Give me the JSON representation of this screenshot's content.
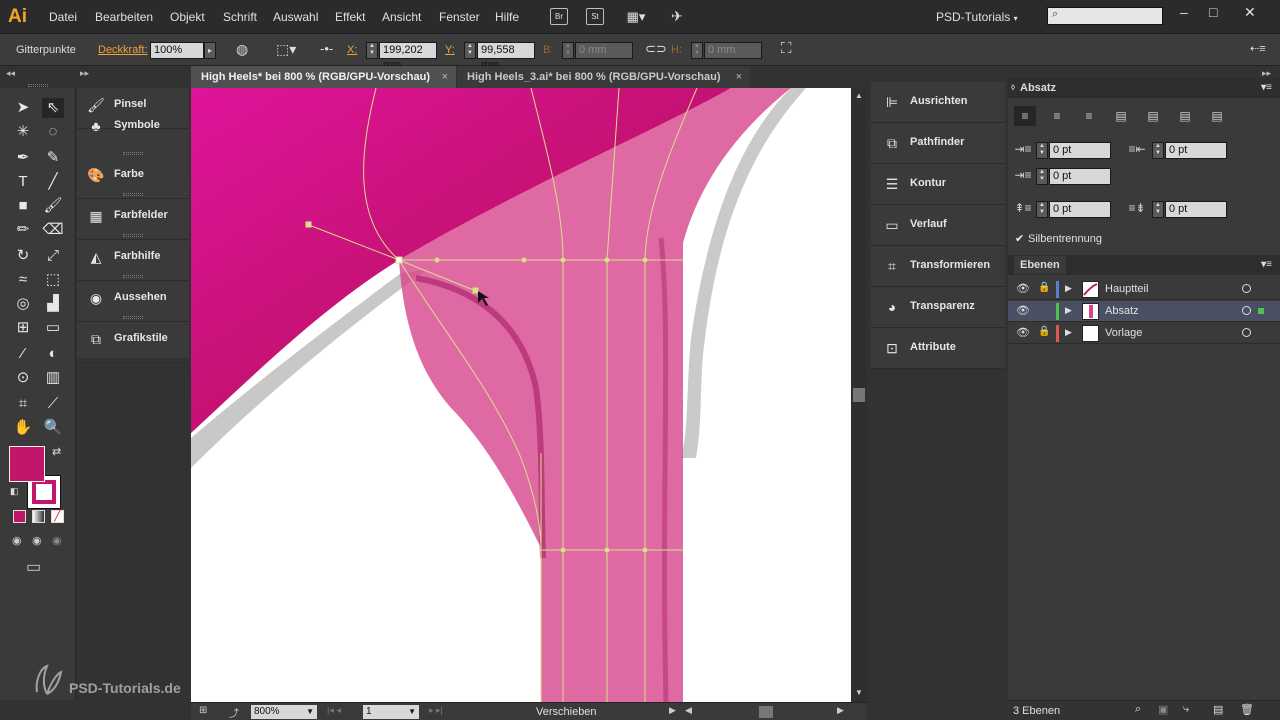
{
  "app": {
    "logo": "Ai",
    "menu": [
      "Datei",
      "Bearbeiten",
      "Objekt",
      "Schrift",
      "Auswahl",
      "Effekt",
      "Ansicht",
      "Fenster",
      "Hilfe"
    ],
    "bridge_icon": "Br",
    "stock_icon": "St",
    "workspace": "PSD-Tutorials"
  },
  "control_bar": {
    "selection_label": "Gitterpunkte",
    "opacity_label": "Deckkraft:",
    "opacity_value": "100%",
    "x_label": "X:",
    "x_value": "199,202 mm",
    "y_label": "Y:",
    "y_value": "99,558 mm",
    "b_label": "B:",
    "b_value": "0 mm",
    "h_label": "H:",
    "h_value": "0 mm"
  },
  "tabs": [
    {
      "label": "High Heels* bei 800 % (RGB/GPU-Vorschau)",
      "close": "×"
    },
    {
      "label": "High Heels_3.ai* bei 800 % (RGB/GPU-Vorschau)",
      "close": "×"
    }
  ],
  "left_panels": [
    {
      "label": "Pinsel",
      "icon": "brush-icon"
    },
    {
      "label": "Symbole",
      "icon": "symbols-icon"
    },
    {
      "label": "Farbe",
      "icon": "color-icon"
    },
    {
      "label": "Farbfelder",
      "icon": "swatches-icon"
    },
    {
      "label": "Farbhilfe",
      "icon": "color-guide-icon"
    },
    {
      "label": "Aussehen",
      "icon": "appearance-icon"
    },
    {
      "label": "Grafikstile",
      "icon": "graphic-styles-icon"
    }
  ],
  "right_panels": [
    {
      "label": "Ausrichten",
      "icon": "align-icon"
    },
    {
      "label": "Pathfinder",
      "icon": "pathfinder-icon"
    },
    {
      "label": "Kontur",
      "icon": "stroke-icon"
    },
    {
      "label": "Verlauf",
      "icon": "gradient-icon"
    },
    {
      "label": "Transformieren",
      "icon": "transform-icon"
    },
    {
      "label": "Transparenz",
      "icon": "transparency-icon"
    },
    {
      "label": "Attribute",
      "icon": "attributes-icon"
    }
  ],
  "absatz": {
    "title": "Absatz",
    "left_indent": "0 pt",
    "right_indent": "0 pt",
    "first_line_indent": "0 pt",
    "space_before": "0 pt",
    "space_after": "0 pt",
    "hyphenation_label": "Silbentrennung",
    "hyphenation_checked": true
  },
  "ebenen": {
    "title": "Ebenen",
    "layers": [
      {
        "name": "Hauptteil",
        "color": "#5b7bd5",
        "locked": true
      },
      {
        "name": "Absatz",
        "color": "#4ec24e",
        "locked": false,
        "selected": true
      },
      {
        "name": "Vorlage",
        "color": "#e0565b",
        "locked": true
      }
    ],
    "count": "3 Ebenen"
  },
  "status_bar": {
    "zoom": "800%",
    "artboard": "1",
    "tool_name": "Verschieben"
  },
  "colors": {
    "fill": "#c2166a",
    "accent_magenta": "#e0408e",
    "layer_selected": "#4a4f63"
  },
  "watermark": "PSD-Tutorials.de"
}
